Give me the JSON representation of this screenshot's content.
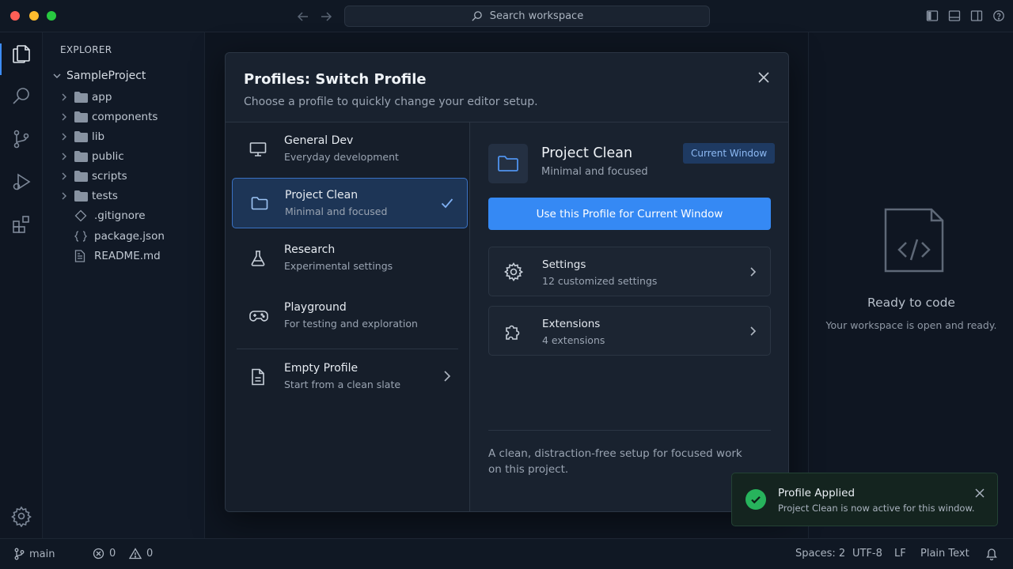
{
  "titlebar": {
    "search_placeholder": "Search workspace"
  },
  "explorer": {
    "title": "EXPLORER",
    "project": "SampleProject",
    "folders": [
      "app",
      "components",
      "lib",
      "public",
      "scripts",
      "tests"
    ],
    "files": [
      ".gitignore",
      "package.json",
      "README.md"
    ]
  },
  "modal": {
    "title": "Profiles: Switch Profile",
    "subtitle": "Choose a profile to quickly change your editor setup.",
    "profiles": [
      {
        "name": "General Dev",
        "description": "Everyday development"
      },
      {
        "name": "Project Clean",
        "description": "Minimal and focused"
      },
      {
        "name": "Research",
        "description": "Experimental settings"
      },
      {
        "name": "Playground",
        "description": "For testing and exploration"
      },
      {
        "name": "Empty Profile",
        "description": "Start from a clean slate"
      }
    ],
    "selected": {
      "name": "Project Clean",
      "description": "Minimal and focused",
      "badge": "Current Window",
      "use_button": "Use this Profile for Current Window",
      "settings_title": "Settings",
      "settings_sub": "12 customized settings",
      "extensions_title": "Extensions",
      "extensions_sub": "4 extensions",
      "summary": "A clean, distraction-free setup for focused work on this project."
    }
  },
  "right_panel": {
    "title": "Ready to code",
    "subtitle": "Your workspace is open and ready."
  },
  "toast": {
    "title": "Profile Applied",
    "message": "Project Clean is now active for this window."
  },
  "statusbar": {
    "branch": "main",
    "errors": "0",
    "warnings": "0",
    "spaces": "Spaces: 2",
    "encoding": "UTF-8",
    "eol": "LF",
    "language": "Plain Text"
  },
  "colors": {
    "accent": "#3589f4",
    "selected_bg": "#1d3556",
    "success": "#27b35c"
  }
}
